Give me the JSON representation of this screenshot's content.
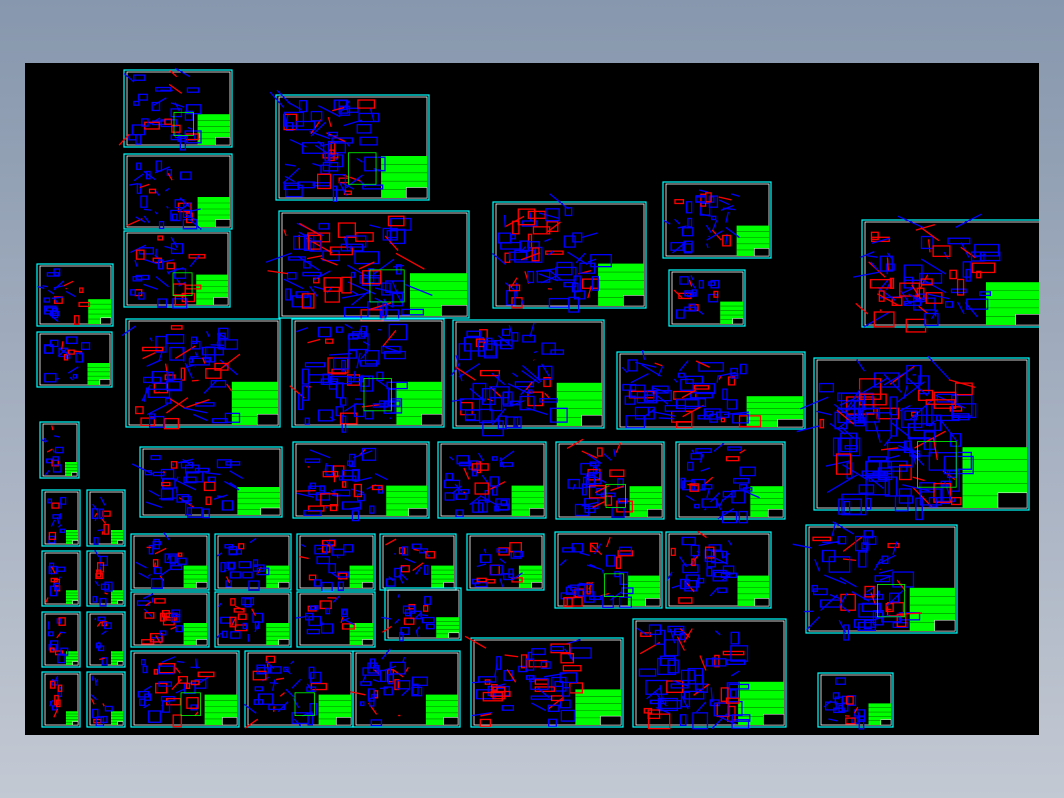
{
  "viewport": {
    "background": "#000000"
  },
  "colors": {
    "sheet_border": "#00ffff",
    "inner_border": "#ffffff",
    "geometry": "#0000ff",
    "highlight": "#ff0000",
    "title_block": "#00ff00",
    "title_lines": "#008800"
  }
}
